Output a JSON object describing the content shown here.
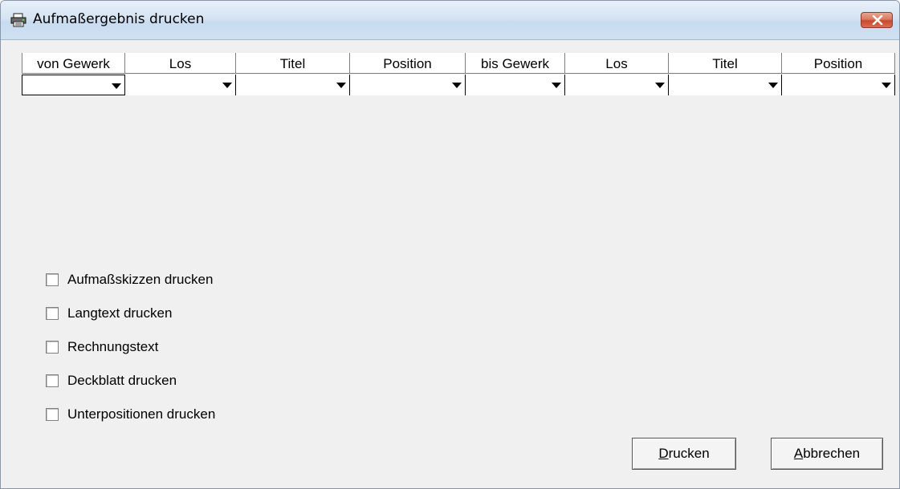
{
  "window": {
    "title": "Aufmaßergebnis drucken",
    "title_icon": "printer-icon",
    "close_icon": "close-icon"
  },
  "grid": {
    "columns": [
      "von Gewerk",
      "Los",
      "Titel",
      "Position",
      "bis Gewerk",
      "Los",
      "Titel",
      "Position"
    ],
    "values": [
      "",
      "",
      "",
      "",
      "",
      "",
      "",
      ""
    ]
  },
  "options": {
    "items": [
      {
        "label": "Aufmaßskizzen drucken",
        "checked": false
      },
      {
        "label": "Langtext drucken",
        "checked": false
      },
      {
        "label": "Rechnungstext",
        "checked": false
      },
      {
        "label": "Deckblatt drucken",
        "checked": false
      },
      {
        "label": "Unterpositionen drucken",
        "checked": false
      }
    ]
  },
  "buttons": {
    "print_label": "Drucken",
    "print_mnemonic": "D",
    "print_rest": "rucken",
    "cancel_label": "Abbrechen",
    "cancel_mnemonic": "A",
    "cancel_rest": "bbrechen"
  },
  "colors": {
    "titlebar": "#d6e4f3",
    "close_button": "#c9482c",
    "background": "#f0f0f0"
  }
}
